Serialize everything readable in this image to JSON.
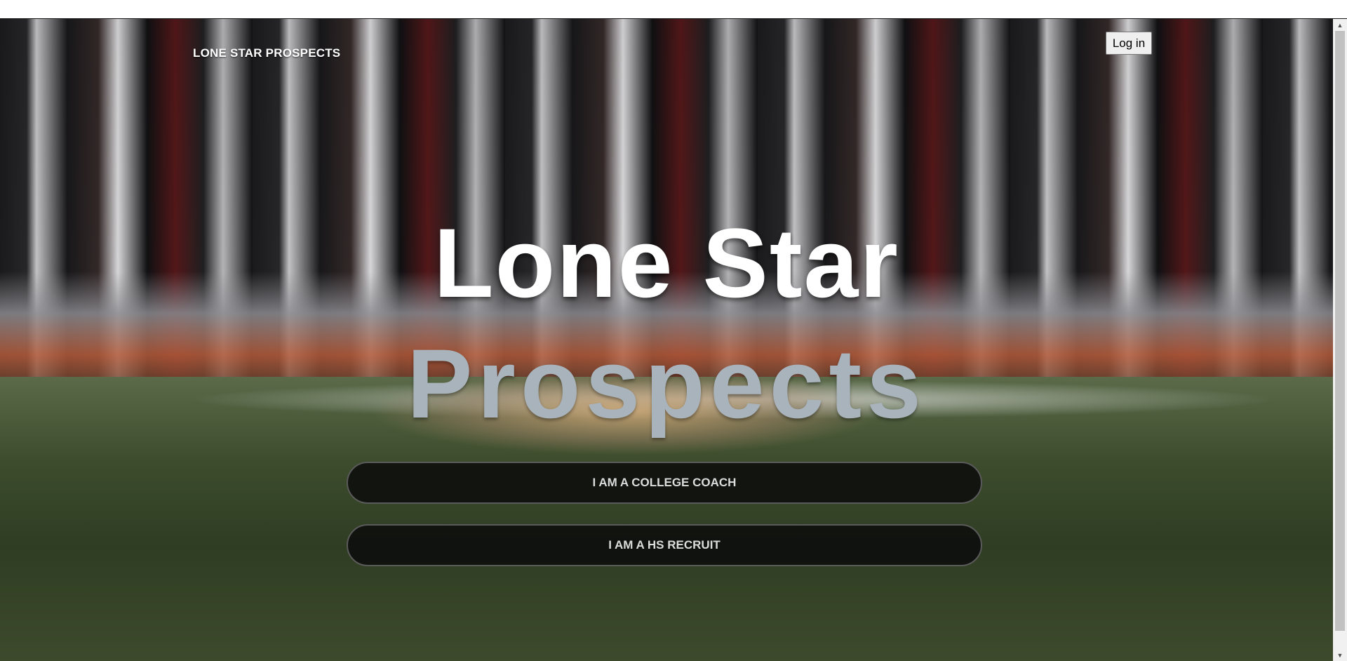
{
  "header": {
    "brand": "LONE STAR PROSPECTS",
    "login_label": "Log in"
  },
  "hero": {
    "title_line1": "Lone Star",
    "title_line2": "Prospects"
  },
  "actions": {
    "coach_label": "I AM A COLLEGE COACH",
    "recruit_label": "I AM A HS RECRUIT"
  },
  "scrollbar": {
    "up_icon": "▲",
    "down_icon": "▼"
  },
  "colors": {
    "title_primary": "#ffffff",
    "title_secondary": "#a9b3bc",
    "button_bg": "#0c0c0c",
    "button_border": "#5a5a5a"
  }
}
